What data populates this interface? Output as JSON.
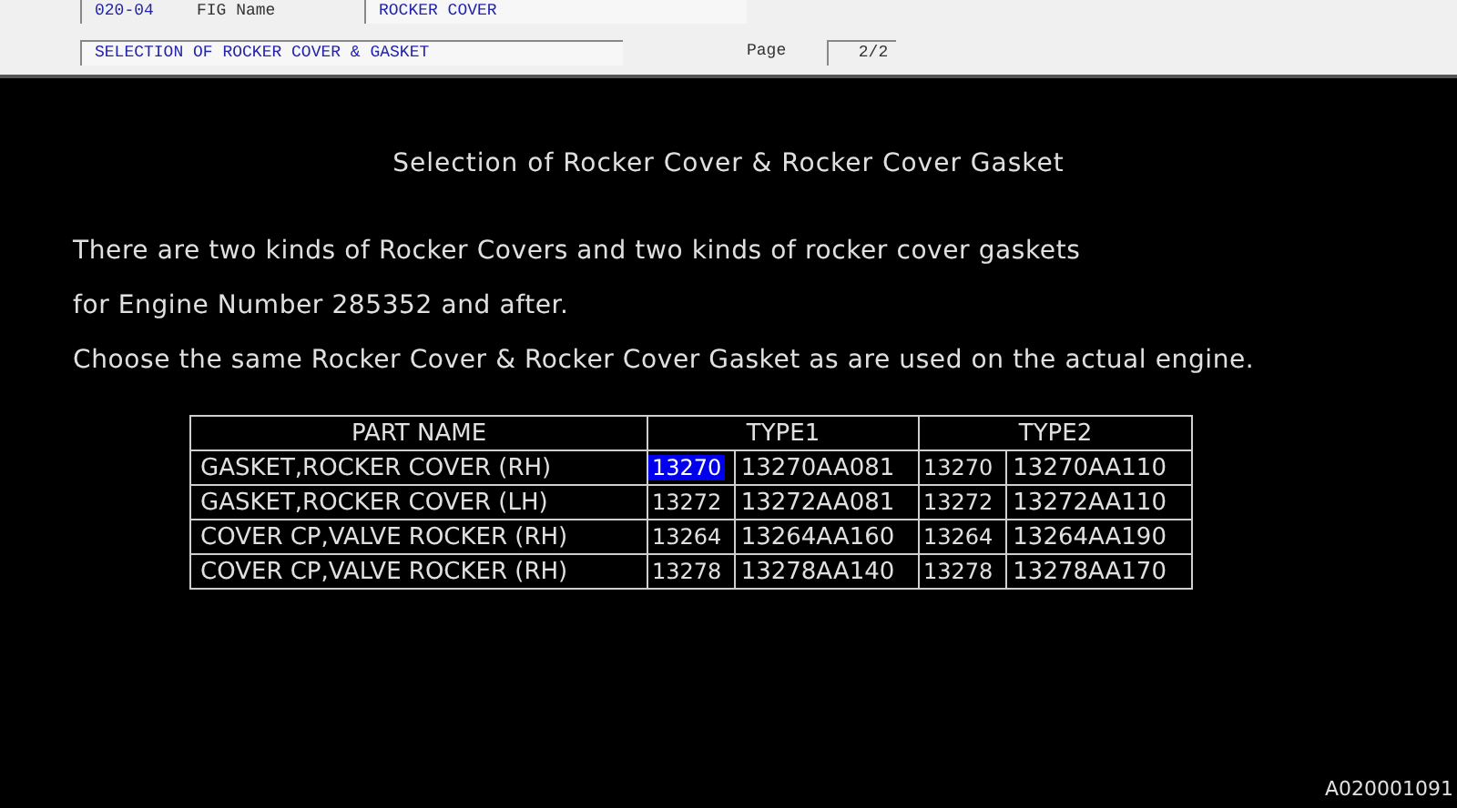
{
  "header": {
    "fig_number": "020-04",
    "fig_name_label": "FIG Name",
    "fig_name": "ROCKER COVER",
    "section": "SELECTION OF ROCKER COVER & GASKET",
    "page_label": "Page",
    "page": "2/2"
  },
  "title": "Selection of Rocker Cover & Rocker Cover Gasket",
  "paragraphs": [
    "There are two kinds of Rocker Covers and two kinds of rocker cover gaskets",
    "for Engine Number 285352 and after.",
    "Choose the same Rocker Cover & Rocker Cover Gasket as are used on the actual engine."
  ],
  "table": {
    "columns": [
      "PART NAME",
      "TYPE1",
      "TYPE2"
    ],
    "rows": [
      {
        "part_name": "GASKET,ROCKER COVER (RH)",
        "type1_code": "13270",
        "type1_selected": true,
        "type1_part": "13270AA081",
        "type2_code": "13270",
        "type2_selected": false,
        "type2_part": "13270AA110"
      },
      {
        "part_name": "GASKET,ROCKER COVER (LH)",
        "type1_code": "13272",
        "type1_selected": false,
        "type1_part": "13272AA081",
        "type2_code": "13272",
        "type2_selected": false,
        "type2_part": "13272AA110"
      },
      {
        "part_name": "COVER CP,VALVE ROCKER (RH)",
        "type1_code": "13264",
        "type1_selected": false,
        "type1_part": "13264AA160",
        "type2_code": "13264",
        "type2_selected": false,
        "type2_part": "13264AA190"
      },
      {
        "part_name": "COVER CP,VALVE ROCKER (RH)",
        "type1_code": "13278",
        "type1_selected": false,
        "type1_part": "13278AA140",
        "type2_code": "13278",
        "type2_selected": false,
        "type2_part": "13278AA170"
      }
    ]
  },
  "footer_code": "A020001091"
}
